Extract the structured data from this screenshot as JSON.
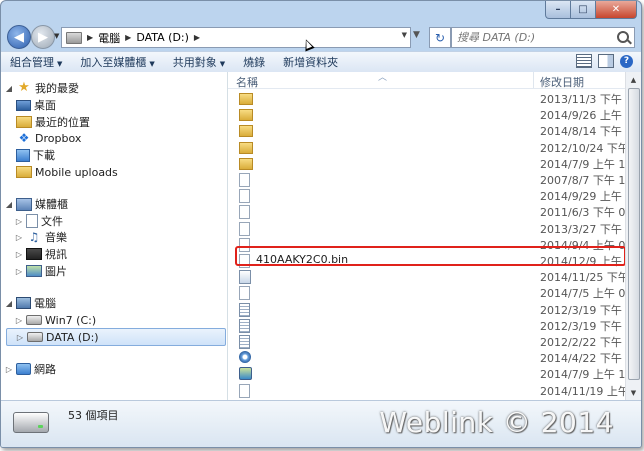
{
  "address": {
    "crumbs": [
      "電腦",
      "DATA (D:)"
    ],
    "search_placeholder": "搜尋 DATA (D:)"
  },
  "toolbar": {
    "organize": "組合管理",
    "add_to_library": "加入至媒體櫃",
    "share_with": "共用對象",
    "burn": "燒錄",
    "new_folder": "新增資料夾"
  },
  "nav": {
    "favorites": "我的最愛",
    "desktop": "桌面",
    "recent": "最近的位置",
    "dropbox": "Dropbox",
    "downloads": "下載",
    "mobile_uploads": "Mobile uploads",
    "libraries": "媒體櫃",
    "documents": "文件",
    "music": "音樂",
    "videos": "視訊",
    "pictures": "圖片",
    "computer": "電腦",
    "win7": "Win7 (C:)",
    "data": "DATA (D:)",
    "network": "網路"
  },
  "columns": {
    "name": "名稱",
    "date_modified": "修改日期"
  },
  "files": [
    {
      "name": "",
      "date": "2013/11/3 下午 07:",
      "type": "folder"
    },
    {
      "name": "",
      "date": "2014/9/26 上午 09:5",
      "type": "folder"
    },
    {
      "name": "",
      "date": "2014/8/14 下午 05:2",
      "type": "folder"
    },
    {
      "name": "",
      "date": "2012/10/24 下午 05:",
      "type": "folder"
    },
    {
      "name": "",
      "date": "2014/7/9 上午 11:12",
      "type": "folder"
    },
    {
      "name": "",
      "date": "2007/8/7 下午 11:47",
      "type": "file"
    },
    {
      "name": "",
      "date": "2014/9/29 上午 06:2",
      "type": "file"
    },
    {
      "name": "",
      "date": "2011/6/3 下午 01:39",
      "type": "file"
    },
    {
      "name": "",
      "date": "2013/3/27 下午 05:1",
      "type": "file"
    },
    {
      "name": "",
      "date": "2014/9/4 上午 09:12",
      "type": "file"
    },
    {
      "name": "410AAKY2C0.bin",
      "date": "2014/12/9 上午 08:",
      "type": "file"
    },
    {
      "name": "",
      "date": "2014/11/25 下午 03:",
      "type": "img"
    },
    {
      "name": "",
      "date": "2014/7/5 上午 05:22",
      "type": "file"
    },
    {
      "name": "",
      "date": "2012/3/19 下午 01:4",
      "type": "text"
    },
    {
      "name": "",
      "date": "2012/3/19 下午 01:5",
      "type": "text"
    },
    {
      "name": "",
      "date": "2012/2/22 下午 04:5",
      "type": "text"
    },
    {
      "name": "",
      "date": "2014/4/22 下午 07:2",
      "type": "disc"
    },
    {
      "name": "",
      "date": "2014/7/9 上午 11:11",
      "type": "app"
    },
    {
      "name": "",
      "date": "2014/11/19 上午 10:",
      "type": "file"
    }
  ],
  "status": {
    "item_count": "53 個項目"
  },
  "watermark": "Weblink © 2014"
}
